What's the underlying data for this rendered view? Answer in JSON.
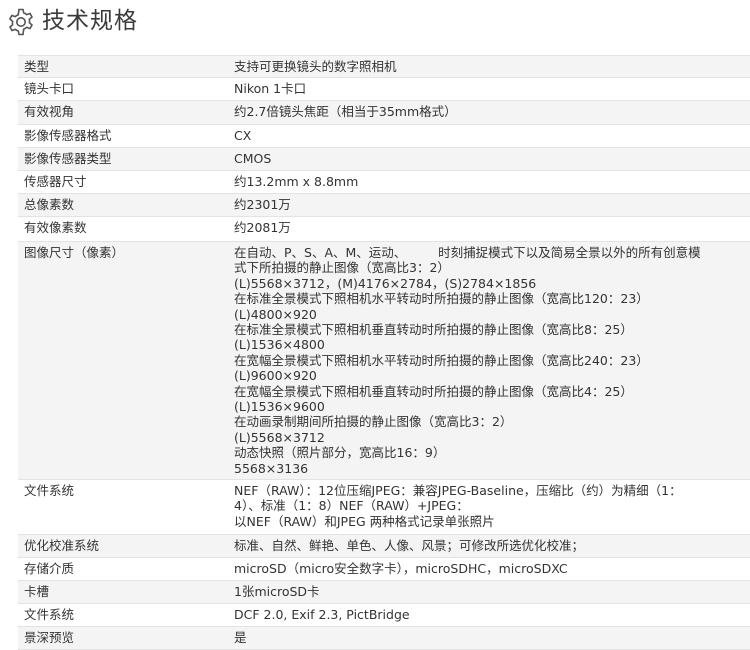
{
  "header": {
    "title": "技术规格",
    "icon": "gear-icon"
  },
  "specs": [
    {
      "label": "类型",
      "lines": [
        "支持可更换镜头的数字照相机"
      ]
    },
    {
      "label": "镜头卡口",
      "lines": [
        "Nikon 1卡口"
      ]
    },
    {
      "label": "有效视角",
      "lines": [
        "约2.7倍镜头焦距（相当于35mm格式）"
      ]
    },
    {
      "label": "影像传感器格式",
      "lines": [
        "CX"
      ]
    },
    {
      "label": "影像传感器类型",
      "lines": [
        "CMOS"
      ]
    },
    {
      "label": "传感器尺寸",
      "lines": [
        "约13.2mm x 8.8mm"
      ]
    },
    {
      "label": "总像素数",
      "lines": [
        "约2301万"
      ]
    },
    {
      "label": "有效像素数",
      "lines": [
        "约2081万"
      ]
    },
    {
      "label": "图像尺寸（像素）",
      "lines": [
        "在自动、P、S、A、M、运动、        时刻捕捉模式下以及简易全景以外的所有创意模",
        "式下所拍摄的静止图像（宽高比3：2）",
        "(L)5568×3712，(M)4176×2784，(S)2784×1856",
        "在标准全景模式下照相机水平转动时所拍摄的静止图像（宽高比120：23）",
        "(L)4800×920",
        "在标准全景模式下照相机垂直转动时所拍摄的静止图像（宽高比8：25）",
        "(L)1536×4800",
        "在宽幅全景模式下照相机水平转动时所拍摄的静止图像（宽高比240：23）",
        "(L)9600×920",
        "在宽幅全景模式下照相机垂直转动时所拍摄的静止图像（宽高比4：25）",
        "(L)1536×9600",
        "在动画录制期间所拍摄的静止图像（宽高比3：2）",
        "(L)5568×3712",
        "动态快照（照片部分，宽高比16：9）",
        "5568×3136"
      ]
    },
    {
      "label": "文件系统",
      "lines": [
        "NEF（RAW）：12位压缩JPEG：兼容JPEG-Baseline，压缩比（约）为精细（1：",
        "4）、标准（1：8）NEF（RAW）+JPEG：",
        "以NEF（RAW）和JPEG 两种格式记录单张照片"
      ]
    },
    {
      "label": "优化校准系统",
      "lines": [
        "标准、自然、鲜艳、单色、人像、风景；可修改所选优化校准；"
      ]
    },
    {
      "label": "存储介质",
      "lines": [
        "microSD（micro安全数字卡），microSDHC，microSDXC"
      ]
    },
    {
      "label": "卡槽",
      "lines": [
        "1张microSD卡"
      ]
    },
    {
      "label": "文件系统",
      "lines": [
        "DCF 2.0, Exif 2.3, PictBridge"
      ]
    },
    {
      "label": "景深预览",
      "lines": [
        "是"
      ]
    }
  ]
}
